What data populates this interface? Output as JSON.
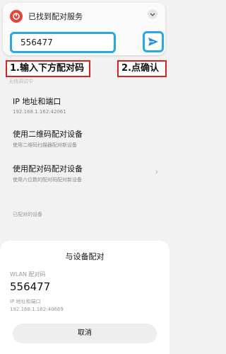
{
  "notification": {
    "title": "已找到配对服务",
    "app_icon": "red-app-icon",
    "input_value": "556477",
    "send_icon": "send-arrow-icon",
    "accent_color": "#2aa8e6"
  },
  "annotations": {
    "step1": "1.输入下方配对码",
    "step2": "2.点确认",
    "border_color": "#d9231d"
  },
  "settings": {
    "partial_label": "无线调试中",
    "ip_port": {
      "title": "IP 地址和端口",
      "value": "192.168.1.162:42061"
    },
    "qr_pair": {
      "title": "使用二维码配对设备",
      "subtitle": "使用二维码扫描器配对新设备"
    },
    "code_pair": {
      "title": "使用配对码配对设备",
      "subtitle": "使用六位数的配对码配对新设备"
    },
    "paired_section": "已配对的设备"
  },
  "dialog": {
    "title": "与设备配对",
    "wlan_label": "WLAN 配对码",
    "wlan_code": "556477",
    "ip_label": "IP 地址和端口",
    "ip_value": "192.168.1.162:40669",
    "cancel_label": "取消"
  }
}
